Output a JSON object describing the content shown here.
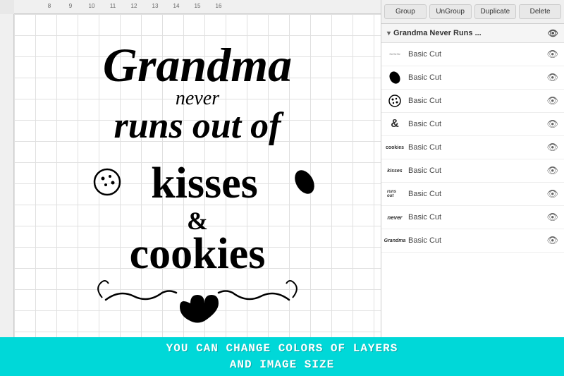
{
  "toolbar": {
    "group_label": "Group",
    "ungroup_label": "UnGroup",
    "duplicate_label": "Duplicate",
    "delete_label": "Delete"
  },
  "panel": {
    "header_title": "Grandma Never Runs ...",
    "eye_icon": "👁"
  },
  "layers": [
    {
      "id": 1,
      "thumb": "~~~",
      "name": "Basic Cut",
      "thumb_text": "≈≈≈"
    },
    {
      "id": 2,
      "thumb": "🍃",
      "name": "Basic Cut",
      "thumb_text": "🍃"
    },
    {
      "id": 3,
      "thumb": "🍪",
      "name": "Basic Cut",
      "thumb_text": "🍪"
    },
    {
      "id": 4,
      "thumb": "&",
      "name": "Basic Cut",
      "thumb_text": "&"
    },
    {
      "id": 5,
      "thumb": "cookies",
      "name": "Basic Cut",
      "thumb_text": "cookies"
    },
    {
      "id": 6,
      "thumb": "kisses",
      "name": "Basic Cut",
      "thumb_text": "kisses"
    },
    {
      "id": 7,
      "thumb": "runs out of",
      "name": "Basic Cut",
      "thumb_text": "runs out"
    },
    {
      "id": 8,
      "thumb": "never",
      "name": "Basic Cut",
      "thumb_text": "never"
    },
    {
      "id": 9,
      "thumb": "Grandma",
      "name": "Basic Cut",
      "thumb_text": "Grandma"
    }
  ],
  "ruler": {
    "ticks": [
      "8",
      "9",
      "10",
      "11",
      "12",
      "13",
      "14",
      "15",
      "16"
    ]
  },
  "banner": {
    "line1": "YOU CAN CHANGE COLORS OF LAYERS",
    "line2": "AND IMAGE SIZE"
  }
}
